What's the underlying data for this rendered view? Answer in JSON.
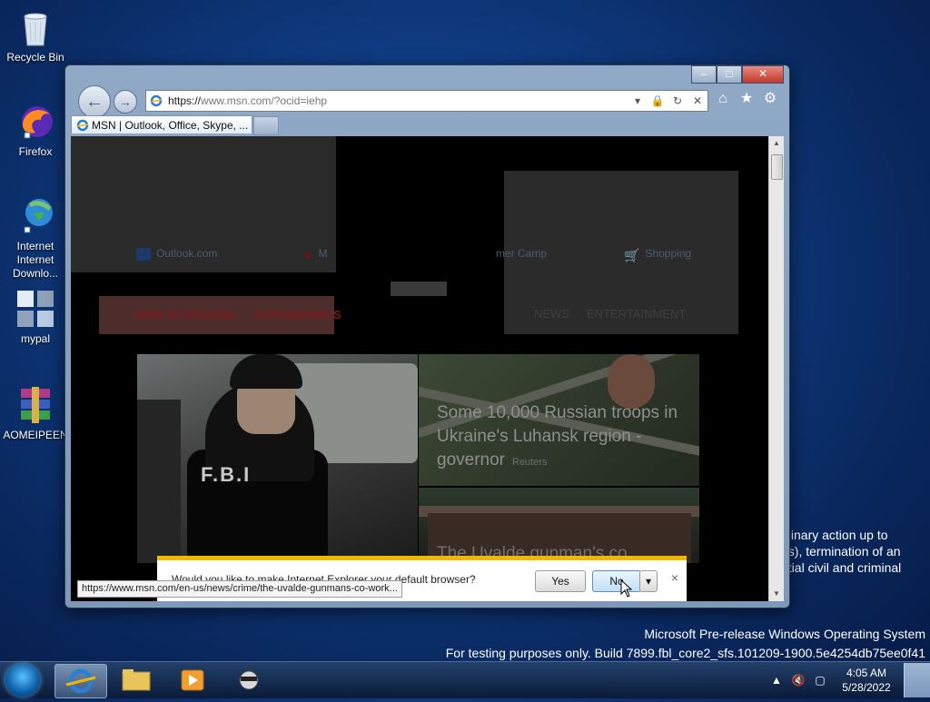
{
  "desktop": {
    "icons": [
      {
        "label": "Recycle Bin"
      },
      {
        "label": "Firefox"
      },
      {
        "label": "Internet Downlo..."
      },
      {
        "label": "mypal"
      },
      {
        "label": "AOMEIPEEN"
      }
    ],
    "background_text": [
      "plinary action up to",
      "es), termination of an",
      "ntial civil and criminal"
    ],
    "watermark": {
      "line1": "Microsoft Pre-release Windows Operating System",
      "line2": "For testing purposes only. Build 7899.fbl_core2_sfs.101209-1900.5e4254db75ee0f41"
    }
  },
  "browser": {
    "address_prefix": "https://",
    "address_host": "www.msn.com",
    "address_rest": "/?ocid=iehp",
    "tab_title": "MSN | Outlook, Office, Skype, ...",
    "page": {
      "top_links": [
        "Outlook.com",
        "M",
        "mer Camp",
        "Shopping"
      ],
      "nav_left": [
        "WAR IN UKRAINE",
        "CORONAVIRUS"
      ],
      "nav_right": [
        "NEWS",
        "ENTERTAINMENT"
      ],
      "headline": "Some 10,000 Russian troops in Ukraine's Luhansk region - governor",
      "headline_source": "Reuters",
      "hero_badge": "F.B.I",
      "second_headline": "The Uvalde gunman's co..."
    },
    "notification": {
      "message": "Would you like to make Internet Explorer your default browser?",
      "yes_label": "Yes",
      "no_label": "No",
      "close_label": "×"
    },
    "status_url": "https://www.msn.com/en-us/news/crime/the-uvalde-gunmans-co-work..."
  },
  "taskbar": {
    "time": "4:05 AM",
    "date": "5/28/2022"
  },
  "colors": {
    "accent": "#f0b800",
    "nav_red": "#7a1b1b"
  }
}
